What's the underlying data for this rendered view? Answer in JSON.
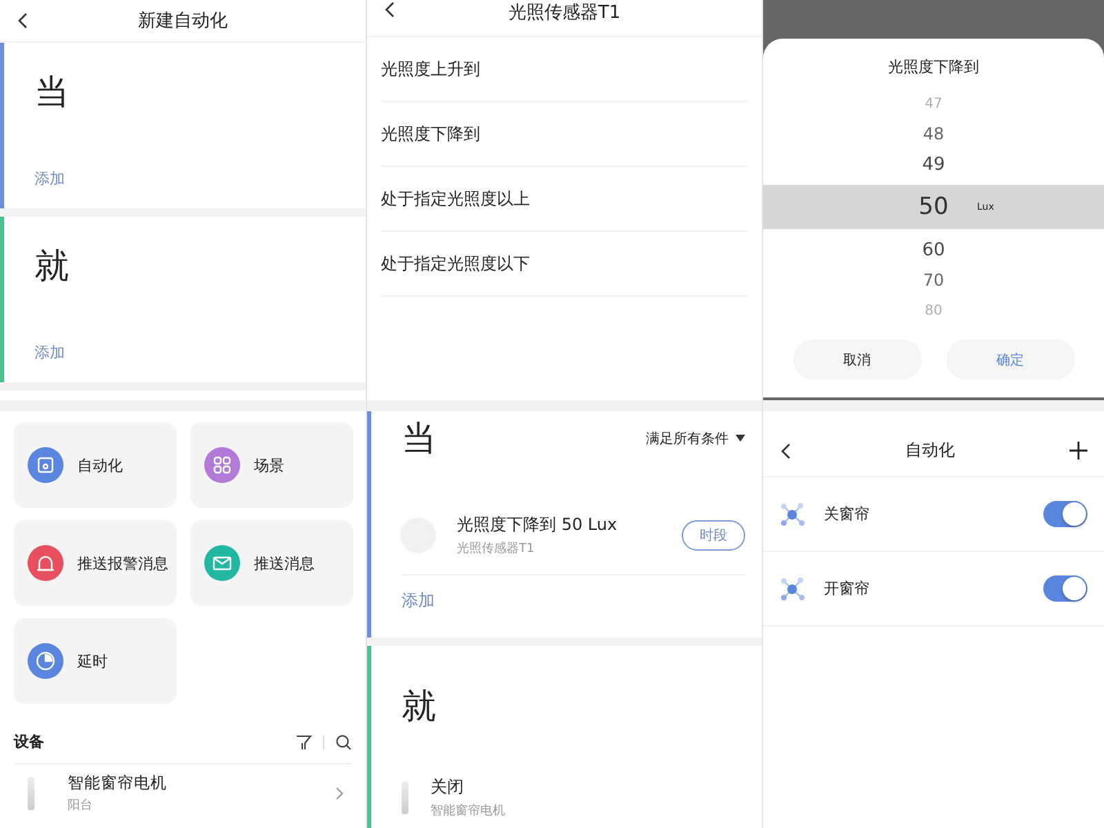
{
  "new_automation": {
    "title": "新建自动化",
    "sections": [
      {
        "kind": "when",
        "heading": "当",
        "add": "添加"
      },
      {
        "kind": "then",
        "heading": "就",
        "add": "添加"
      }
    ]
  },
  "action_picker": {
    "tiles": [
      {
        "label": "自动化",
        "color": "#5b86e0"
      },
      {
        "label": "场景",
        "color": "#b27ad6"
      },
      {
        "label": "推送报警消息",
        "color": "#e8505f"
      },
      {
        "label": "推送消息",
        "color": "#22b7a0"
      },
      {
        "label": "延时",
        "color": "#5b86e0"
      }
    ],
    "devices_heading": "设备",
    "devices": [
      {
        "name": "智能窗帘电机",
        "room": "阳台"
      }
    ]
  },
  "sensor_options": {
    "title": "光照传感器T1",
    "options": [
      "光照度上升到",
      "光照度下降到",
      "处于指定光照度以上",
      "处于指定光照度以下"
    ]
  },
  "condition_editor": {
    "sections": [
      {
        "kind": "when",
        "heading": "当",
        "match": "满足所有条件",
        "items": [
          {
            "title": "光照度下降到 50 Lux",
            "subtitle": "光照传感器T1",
            "button": "时段"
          }
        ],
        "add": "添加"
      },
      {
        "kind": "then",
        "heading": "就",
        "items": [
          {
            "title": "关闭",
            "subtitle": "智能窗帘电机"
          }
        ]
      }
    ]
  },
  "value_picker": {
    "title": "光照度下降到",
    "unit": "Lux",
    "values": [
      {
        "label": "47",
        "selected": false
      },
      {
        "label": "48",
        "selected": false
      },
      {
        "label": "49",
        "selected": false
      },
      {
        "label": "50",
        "selected": true
      },
      {
        "label": "60",
        "selected": false
      },
      {
        "label": "70",
        "selected": false
      },
      {
        "label": "80",
        "selected": false
      }
    ],
    "cancel": "取消",
    "confirm": "确定"
  },
  "automation_list": {
    "title": "自动化",
    "items": [
      {
        "name": "关窗帘",
        "on": true
      },
      {
        "name": "开窗帘",
        "on": true
      }
    ]
  }
}
